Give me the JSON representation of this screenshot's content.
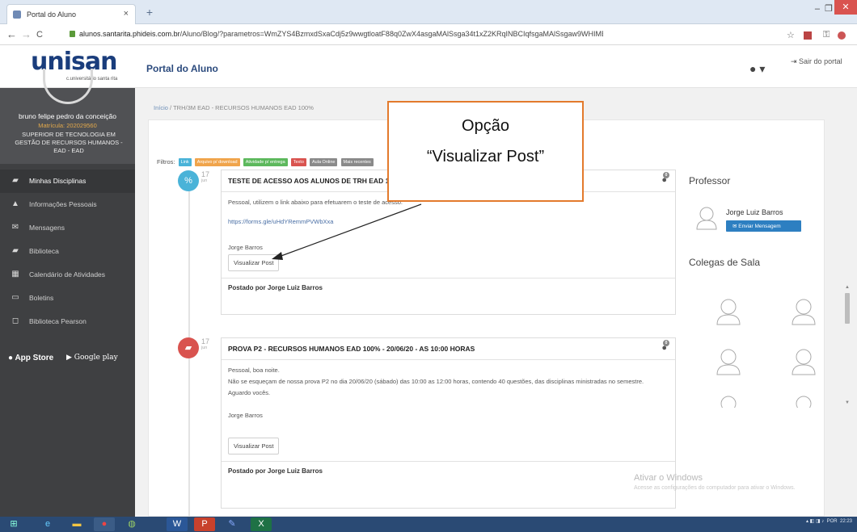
{
  "browser": {
    "tab_title": "Portal do Aluno",
    "tab_close": "×",
    "new_tab": "+",
    "url_domain": "alunos.santarita.phideis.com.br",
    "url_path": "/Aluno/Blog/?parametros=WmZYS4BzmxdSxaCdj5z9wwgtloatF88q0ZwX4asgaMAlSsga34t1xZ2KRqINBCIqfsgaMAlSsgaw9WHIMB13E8vrhzo=",
    "back": "←",
    "forward": "→",
    "reload": "C"
  },
  "header": {
    "logo_text": "unisan",
    "logo_tagline": "c.universitário santa rita",
    "title": "Portal do Aluno",
    "logout": "Sair do portal"
  },
  "profile": {
    "name": "bruno felipe pedro da conceição",
    "matricula": "Matrícula: 202029560",
    "course": "SUPERIOR DE TECNOLOGIA EM GESTÃO DE RECURSOS HUMANOS - EAD - EAD"
  },
  "menu": {
    "items": [
      {
        "label": "Minhas Disciplinas",
        "icon": "book-icon",
        "glyph": "▰"
      },
      {
        "label": "Informações Pessoais",
        "icon": "user-icon",
        "glyph": "▲"
      },
      {
        "label": "Mensagens",
        "icon": "envelope-icon",
        "glyph": "✉"
      },
      {
        "label": "Biblioteca",
        "icon": "book-icon",
        "glyph": "▰"
      },
      {
        "label": "Calendário de Atividades",
        "icon": "calendar-icon",
        "glyph": "▦"
      },
      {
        "label": "Boletins",
        "icon": "card-icon",
        "glyph": "▭"
      },
      {
        "label": "Biblioteca Pearson",
        "icon": "bookmark-icon",
        "glyph": "◻"
      }
    ]
  },
  "stores": {
    "apple": "App Store",
    "google": "Google play"
  },
  "breadcrumb": {
    "home": "Início",
    "sep": "/",
    "current": "TRH/3M EAD - RECURSOS HUMANOS EAD 100%"
  },
  "filters": {
    "label": "Filtros:",
    "chips": [
      {
        "label": "Link",
        "color": "#4ab3d8"
      },
      {
        "label": "Arquivo p/ download",
        "color": "#f0a44b"
      },
      {
        "label": "Atividade p/ entrega",
        "color": "#5cb85c"
      },
      {
        "label": "Texto",
        "color": "#d9534f"
      },
      {
        "label": "Aula Online",
        "color": "#8a8a8a"
      },
      {
        "label": "Mais recentes",
        "color": "#8a8a8a"
      }
    ]
  },
  "posts": [
    {
      "day": "17",
      "month": "jun",
      "title": "TESTE DE ACESSO AOS ALUNOS DE TRH EAD 100%",
      "comments": "0",
      "intro": "Pessoal, utilizem o link abaixo para efetuarem o teste de acesso.",
      "link": "https://forms.gle/uHdYRemmPVWbXxa",
      "signature": "Jorge Barros",
      "button": "Visualizar Post",
      "footer": "Postado por Jorge Luiz Barros",
      "color": "#4ab3d8"
    },
    {
      "day": "17",
      "month": "jun",
      "title": "PROVA P2 - RECURSOS HUMANOS EAD 100% - 20/06/20 - AS 10:00 HORAS",
      "comments": "0",
      "greeting": "Pessoal, boa noite.",
      "body": "Não se esqueçam de nossa prova P2 no dia 20/06/20 (sábado) das 10:00 as 12:00 horas, contendo 40 questões, das disciplinas ministradas no semestre.",
      "closing": "Aguardo vocês.",
      "signature": "Jorge Barros",
      "button": "Visualizar Post",
      "footer": "Postado por Jorge Luiz Barros",
      "color": "#d9534f"
    }
  ],
  "right": {
    "professor_title": "Professor",
    "professor_name": "Jorge Luiz Barros",
    "send_message": "Enviar Mensagem",
    "classmates_title": "Colegas de Sala"
  },
  "annotation": {
    "line1": "Opção",
    "line2": "“Visualizar Post”"
  },
  "windows": {
    "activate_title": "Ativar o Windows",
    "activate_sub": "Acesse as configurações do computador para ativar o Windows.",
    "tray_lang": "POR",
    "tray_time": "22:23"
  }
}
